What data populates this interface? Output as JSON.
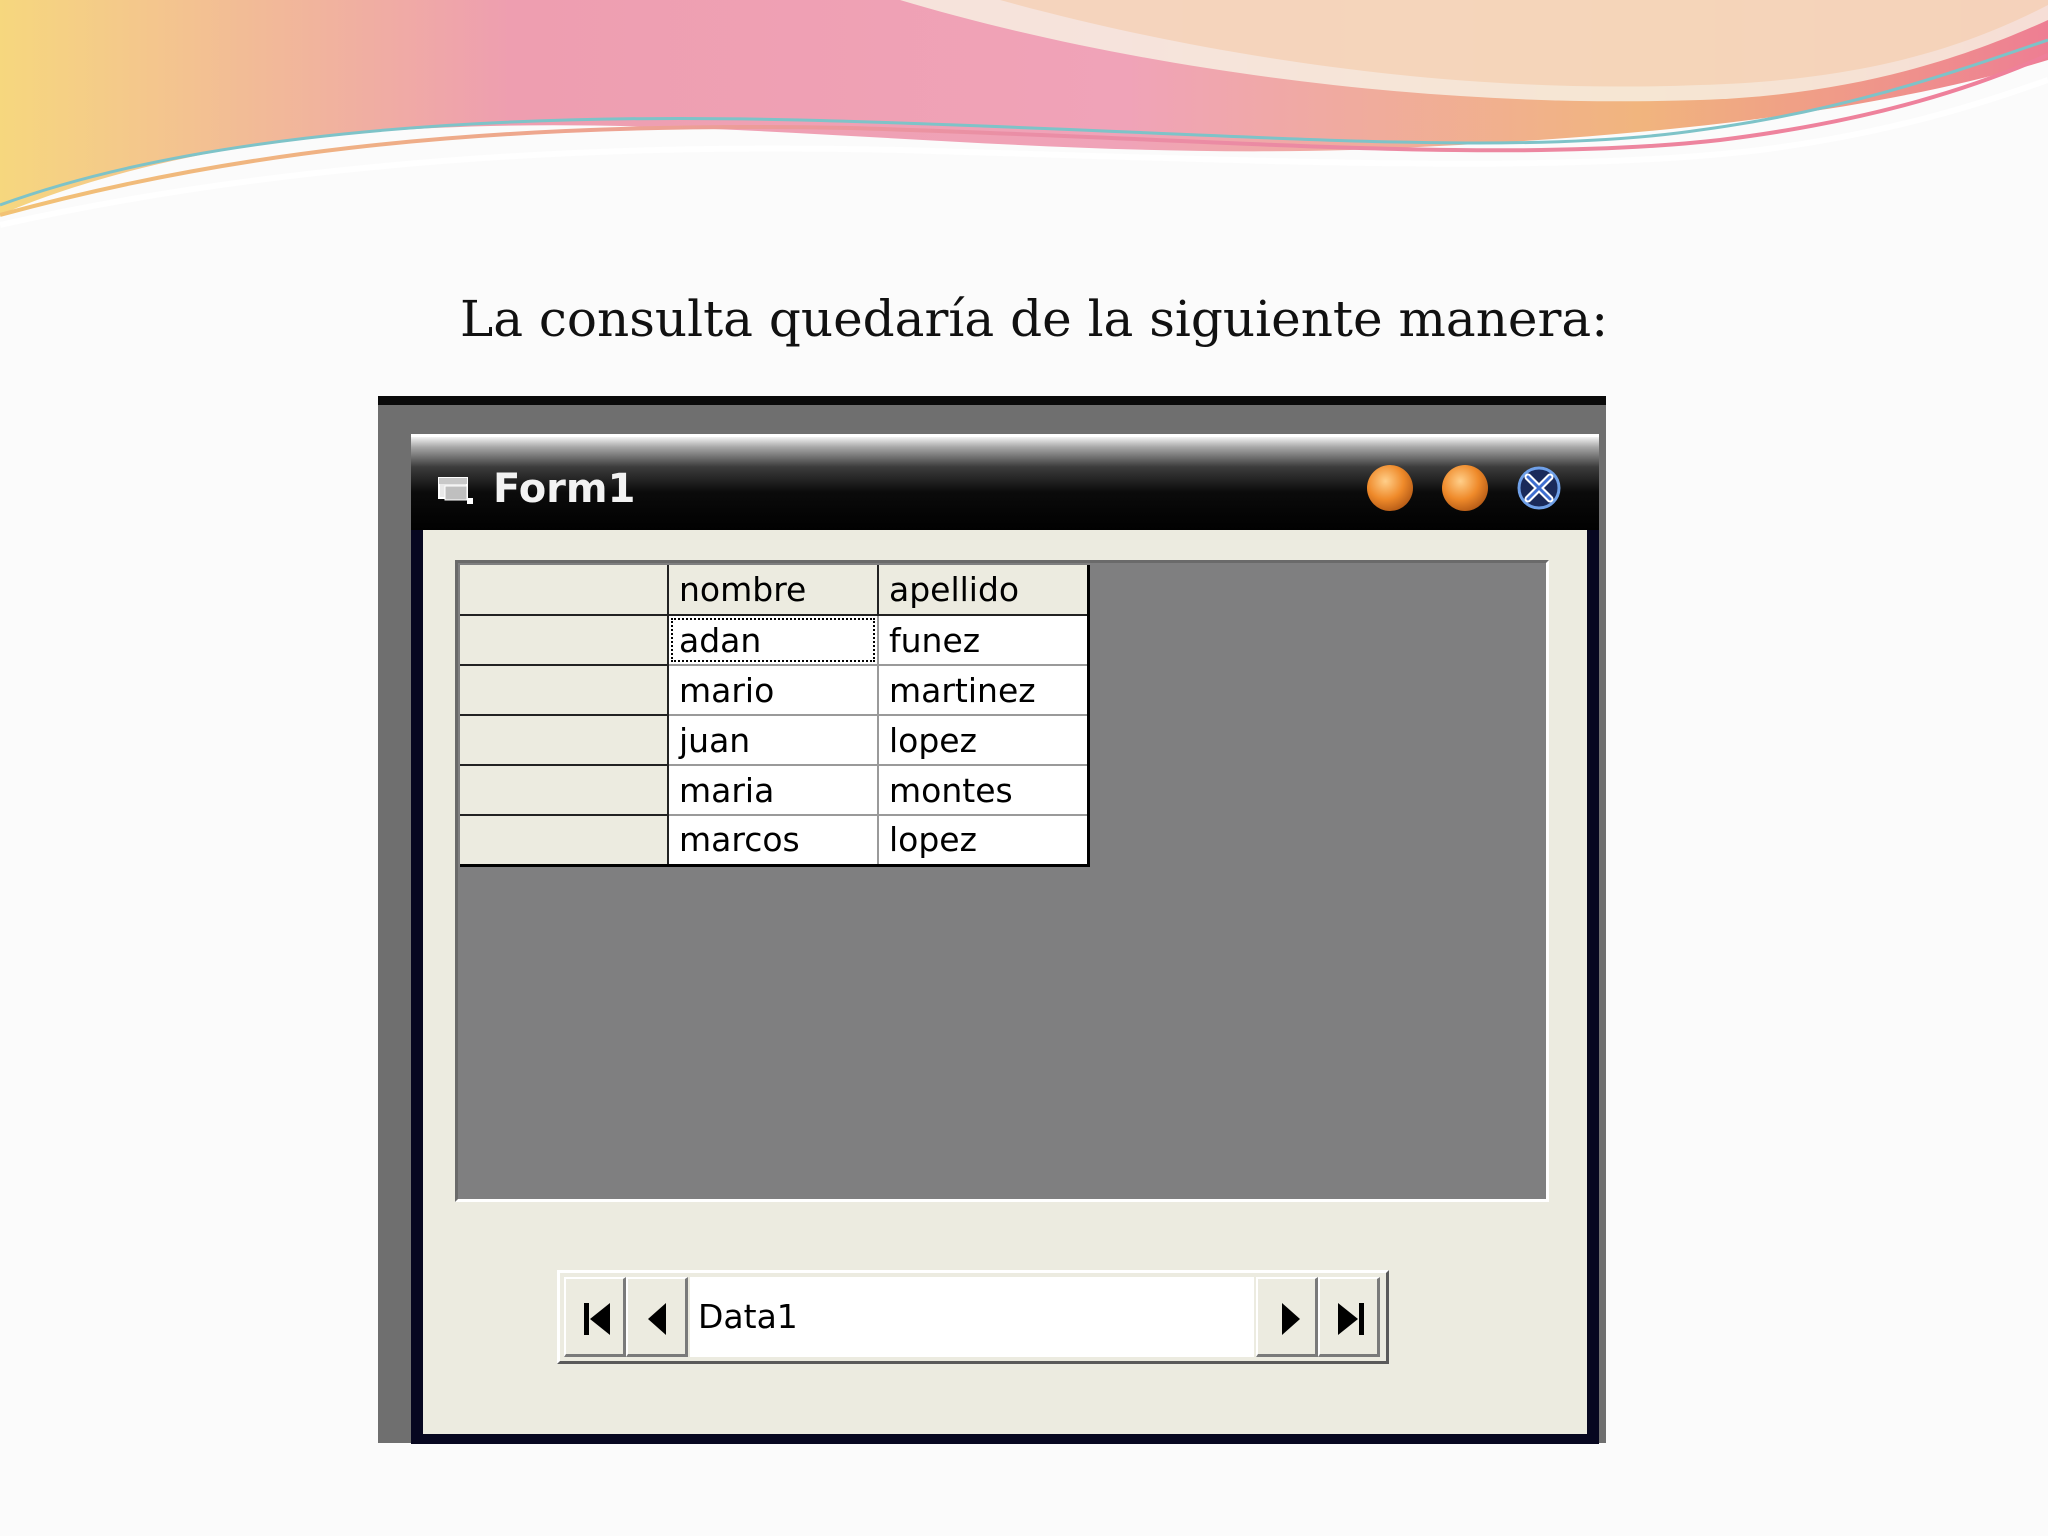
{
  "slide": {
    "caption": "La consulta quedaría de la siguiente manera:"
  },
  "window": {
    "title": "Form1",
    "icons": {
      "app": "form-icon",
      "minimize": "minimize-button",
      "maximize": "maximize-button",
      "close": "close-icon"
    }
  },
  "grid": {
    "columns": [
      "nombre",
      "apellido"
    ],
    "rows": [
      [
        "adan",
        "funez"
      ],
      [
        "mario",
        "martinez"
      ],
      [
        "juan",
        "lopez"
      ],
      [
        "maria",
        "montes"
      ],
      [
        "marcos",
        "lopez"
      ]
    ]
  },
  "data_control": {
    "caption": "Data1",
    "icons": [
      "move-first-icon",
      "move-previous-icon",
      "move-next-icon",
      "move-last-icon"
    ]
  },
  "colors": {
    "accent_orange": "#ef8a2a",
    "grid_background": "#7f7f80",
    "window_face": "#ecebe0"
  }
}
